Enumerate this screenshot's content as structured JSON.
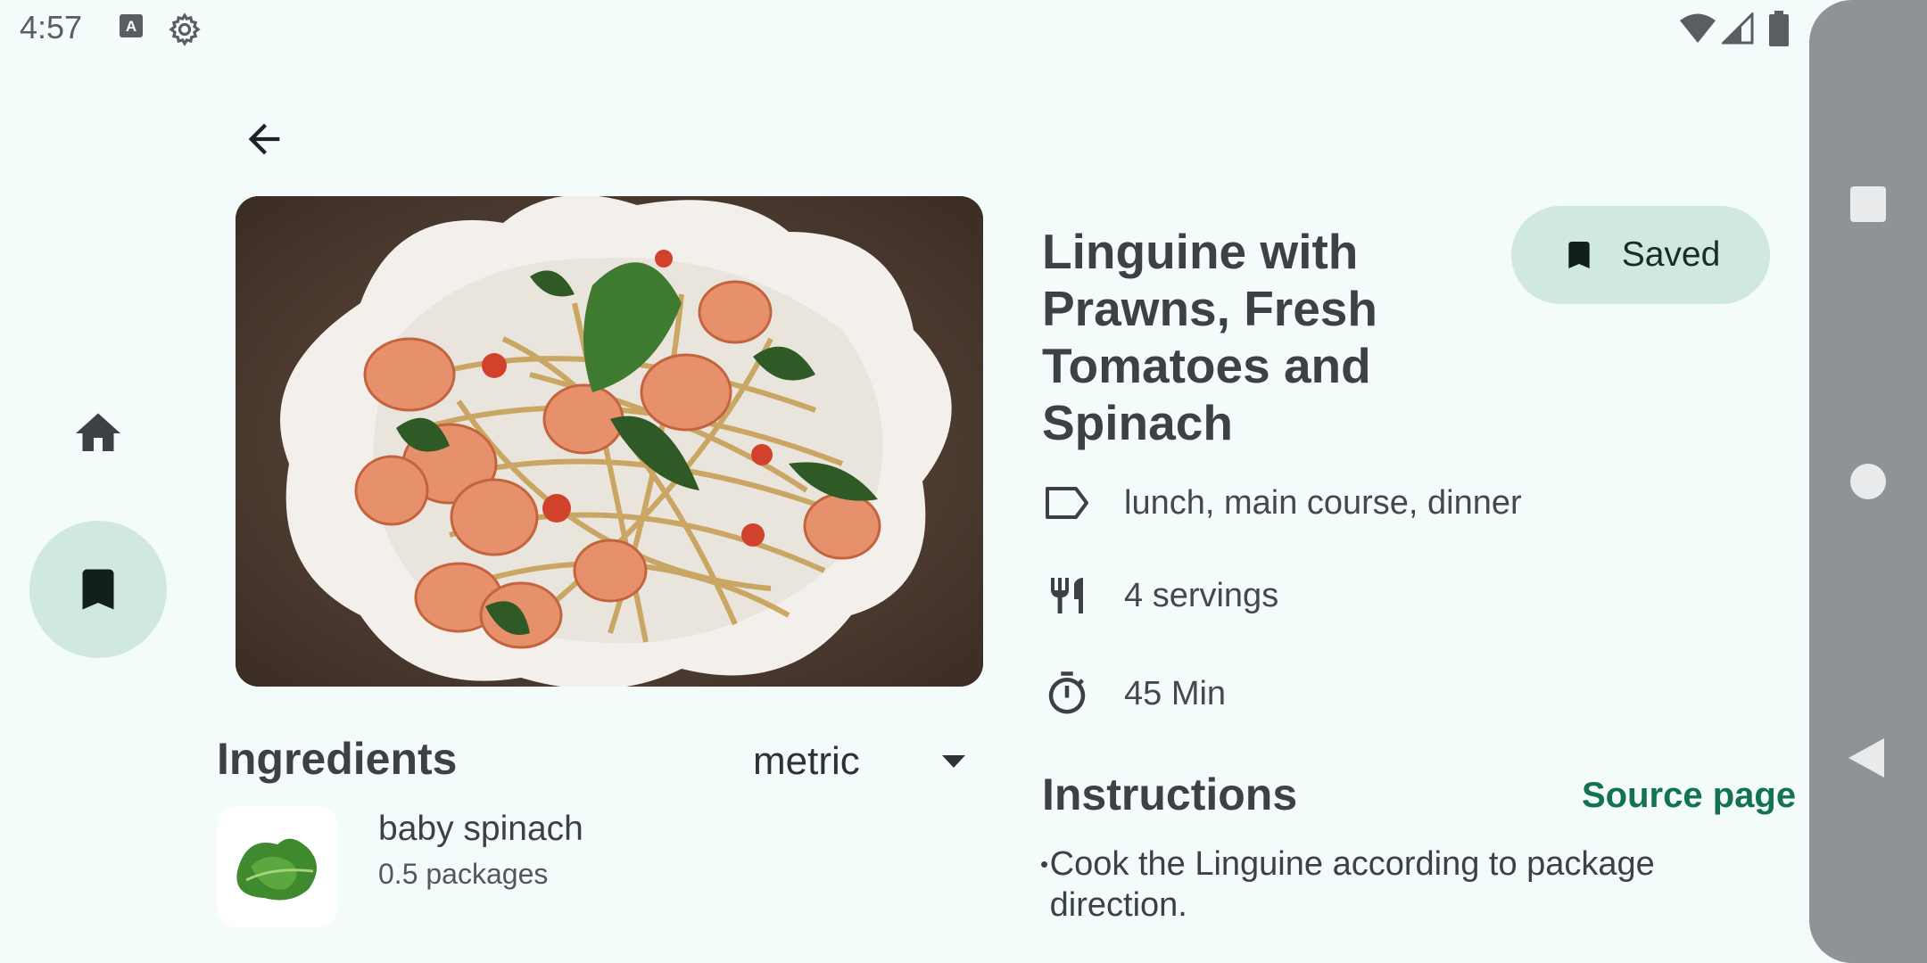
{
  "status_bar": {
    "time": "4:57"
  },
  "recipe": {
    "title": "Linguine with Prawns, Fresh Tomatoes and Spinach",
    "title_lines": [
      "Linguine with",
      "Prawns, Fresh",
      "Tomatoes and",
      "Spinach"
    ],
    "saved_label": "Saved",
    "tags": "lunch, main course, dinner",
    "servings": "4 servings",
    "time": "45 Min"
  },
  "ingredients": {
    "heading": "Ingredients",
    "units": "metric",
    "items": [
      {
        "name": "baby spinach",
        "quantity": "0.5 packages"
      }
    ]
  },
  "instructions": {
    "heading": "Instructions",
    "source_label": "Source page",
    "steps": [
      "Cook the Linguine according to package direction."
    ],
    "bullet": "•"
  },
  "colors": {
    "accent": "#137253",
    "chip_bg": "#cfe9e0",
    "background": "#f3fbfb"
  }
}
